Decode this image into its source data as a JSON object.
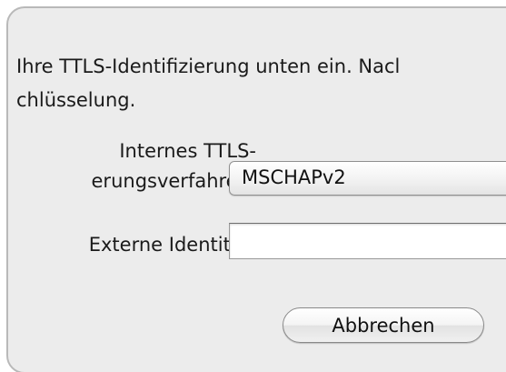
{
  "dialog": {
    "instruction_line1": "Ihre TTLS-Identifizierung unten ein. Nacl",
    "instruction_line2": "chlüsselung.",
    "inner_method_label_line1": "Internes TTLS-",
    "inner_method_label_line2": "erungsverfahren:",
    "inner_method_value": "MSCHAPv2",
    "outer_identity_label": "Externe Identität:",
    "outer_identity_value": "",
    "cancel_button": "Abbrechen"
  }
}
